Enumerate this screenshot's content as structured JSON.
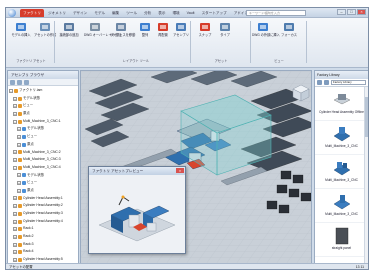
{
  "window": {
    "tabs": [
      "ファクトリ",
      "ジオメトリ",
      "デザイン",
      "モデル",
      "編集",
      "ツール",
      "分析",
      "表示",
      "環境",
      "Vault",
      "スタートアップ",
      "アドイン",
      "オプション"
    ],
    "active_tab": "ファクトリ",
    "search_placeholder": "キーワード/語句を入力",
    "min": "–",
    "max": "□",
    "close": "×"
  },
  "ribbon": {
    "buttons": [
      {
        "label": "モデルの挿入"
      },
      {
        "label": "アセットの作成"
      },
      {
        "label": "接続部の追加"
      },
      {
        "label": "DWG オーバーレイの追加"
      },
      {
        "label": "サーフェスを移動"
      },
      {
        "label": "整列"
      },
      {
        "label": "再配置"
      },
      {
        "label": "アセンブリ"
      },
      {
        "label": "スナップ"
      },
      {
        "label": "タイプ"
      },
      {
        "label": "DWG の外部に挿入"
      },
      {
        "label": "フォーカス"
      }
    ],
    "groups": [
      "ファクトリ アセット",
      "レイアウト ツール",
      "アセット",
      "ビュー"
    ]
  },
  "left_panel": {
    "title": "アセンブリ ブラウザ",
    "tree": [
      "ファクトリ.iam",
      "モデル状態",
      "ビュー",
      "原点",
      "Multi_Machine_3_CNC:1",
      "モデル状態",
      "ビュー",
      "原点",
      "Multi_Machine_3_CNC:2",
      "Multi_Machine_3_CNC:3",
      "Multi_Machine_3_CNC:4",
      "モデル状態",
      "ビュー",
      "原点",
      "Cylinder Head Assembly:1",
      "Cylinder Head Assembly:2",
      "Cylinder Head Assembly:3",
      "Cylinder Head Assembly:4",
      "Rack:1",
      "Rack:2",
      "Rack:3",
      "Rack:4",
      "Cylinder Head Assembly:5",
      "Cylinder Head Assembly:6"
    ]
  },
  "preview": {
    "title": "ファクトリ アセットプレビュー"
  },
  "right_panel": {
    "title": "Factory Library",
    "library_select": "Factory Library",
    "items": [
      {
        "name": "Cylinder Head Assembly Offline"
      },
      {
        "name": "Multi_Machine_3_CNC"
      },
      {
        "name": "Multi_Machine_3_CNC"
      },
      {
        "name": "Multi_Machine_3_CNC"
      },
      {
        "name": "straight panel"
      }
    ]
  },
  "status": {
    "text": "アセットの配置",
    "counts": "13   11"
  },
  "colors": {
    "accent": "#d63c2b",
    "floor": "#c7cfd7",
    "rack": "#6a7a8c",
    "machine_blue": "#2f6fae",
    "selection": "#7ed0d0"
  }
}
